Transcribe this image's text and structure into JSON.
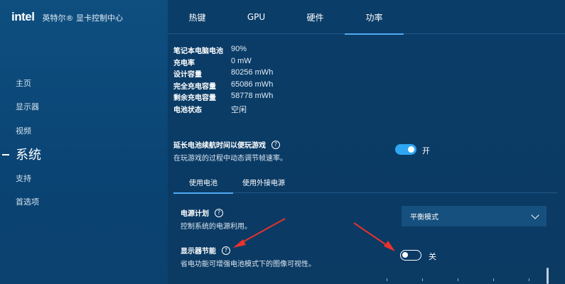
{
  "brand": {
    "logo": "intel",
    "title": "英特尔® 显卡控制中心"
  },
  "nav": {
    "items": [
      {
        "label": "主页"
      },
      {
        "label": "显示器"
      },
      {
        "label": "视频"
      },
      {
        "label": "系统"
      },
      {
        "label": "支持"
      },
      {
        "label": "首选项"
      }
    ]
  },
  "tabs": [
    {
      "label": "热键"
    },
    {
      "label": "GPU"
    },
    {
      "label": "硬件"
    },
    {
      "label": "功率"
    }
  ],
  "battery_info": [
    {
      "key": "笔记本电脑电池",
      "value": "90%"
    },
    {
      "key": "充电率",
      "value": "0 mW"
    },
    {
      "key": "设计容量",
      "value": "80256 mWh"
    },
    {
      "key": "完全充电容量",
      "value": "65086 mWh"
    },
    {
      "key": "剩余充电容量",
      "value": "58778 mWh"
    },
    {
      "key": "电池状态",
      "value": "空闲"
    }
  ],
  "extend_gaming": {
    "title": "延长电池续航时间以便玩游戏",
    "desc": "在玩游戏的过程中动态调节帧速率。",
    "state": "开"
  },
  "subtabs": [
    {
      "label": "使用电池"
    },
    {
      "label": "使用外接电源"
    }
  ],
  "power_plan": {
    "title": "电源计划",
    "desc": "控制系统的电源利用。",
    "selected": "平衡模式"
  },
  "display_saving": {
    "title": "显示器节能",
    "desc": "省电功能可增强电池模式下的图像可视性。",
    "state": "关"
  },
  "help_glyph": "?",
  "colors": {
    "accent": "#2fa6f2",
    "arrow": "#e8322d",
    "sidebar": "#0e4f80",
    "main": "#0a3d68"
  }
}
